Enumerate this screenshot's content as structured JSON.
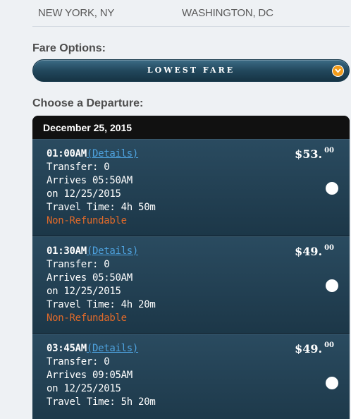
{
  "route": {
    "origin": "NEW YORK, NY",
    "destination": "WASHINGTON, DC"
  },
  "fare_options": {
    "label": "Fare Options:",
    "selected": "LOWEST FARE"
  },
  "departure": {
    "label": "Choose a Departure:",
    "date": "December 25, 2015",
    "flights": [
      {
        "time": "01:00AM",
        "details_label": "(Details)",
        "transfer": "Transfer: 0",
        "arrives": "Arrives 05:50AM",
        "on_date": "on 12/25/2015",
        "travel_time": "Travel Time: 4h 50m",
        "refund": "Non-Refundable",
        "price_dollars": "$53.",
        "price_cents": "00"
      },
      {
        "time": "01:30AM",
        "details_label": "(Details)",
        "transfer": "Transfer: 0",
        "arrives": "Arrives 05:50AM",
        "on_date": "on 12/25/2015",
        "travel_time": "Travel Time: 4h 20m",
        "refund": "Non-Refundable",
        "price_dollars": "$49.",
        "price_cents": "00"
      },
      {
        "time": "03:45AM",
        "details_label": "(Details)",
        "transfer": "Transfer: 0",
        "arrives": "Arrives 09:05AM",
        "on_date": "on 12/25/2015",
        "travel_time": "Travel Time: 5h 20m",
        "refund": "",
        "price_dollars": "$49.",
        "price_cents": "00"
      }
    ]
  },
  "colors": {
    "accent_orange": "#f39c1a",
    "link_blue": "#4ea3e0",
    "refund_orange": "#e06a2a",
    "panel_dark": "#1d3444"
  }
}
